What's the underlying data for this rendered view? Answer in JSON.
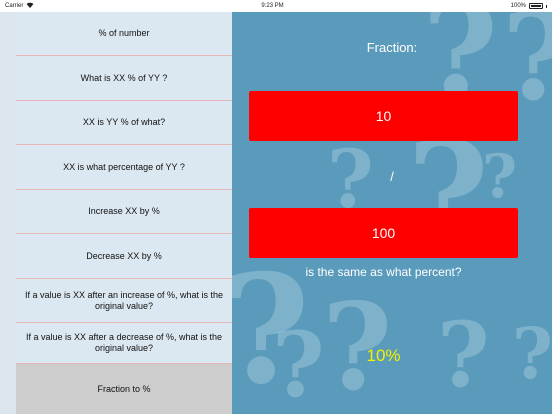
{
  "status_bar": {
    "carrier": "Carrier",
    "time": "9:23 PM",
    "battery": "100%"
  },
  "menu": {
    "items": [
      {
        "label": "% of number"
      },
      {
        "label": "What is XX % of YY ?"
      },
      {
        "label": "XX is YY % of what?"
      },
      {
        "label": "XX is what percentage of YY ?"
      },
      {
        "label": "Increase XX by %"
      },
      {
        "label": "Decrease XX by %"
      },
      {
        "label": "If a value is XX after an increase of %, what is the original value?"
      },
      {
        "label": "If a value is XX after a decrease of %, what is the original value?"
      },
      {
        "label": "Fraction to %"
      }
    ],
    "selected_index": 8
  },
  "panel": {
    "title": "Fraction:",
    "numerator": "10",
    "separator": "/",
    "denominator": "100",
    "question": "is the same as what percent?",
    "result": "10%",
    "field_color": "#ff0000",
    "result_color": "#f2f200",
    "background_color": "#5a9bbb"
  }
}
